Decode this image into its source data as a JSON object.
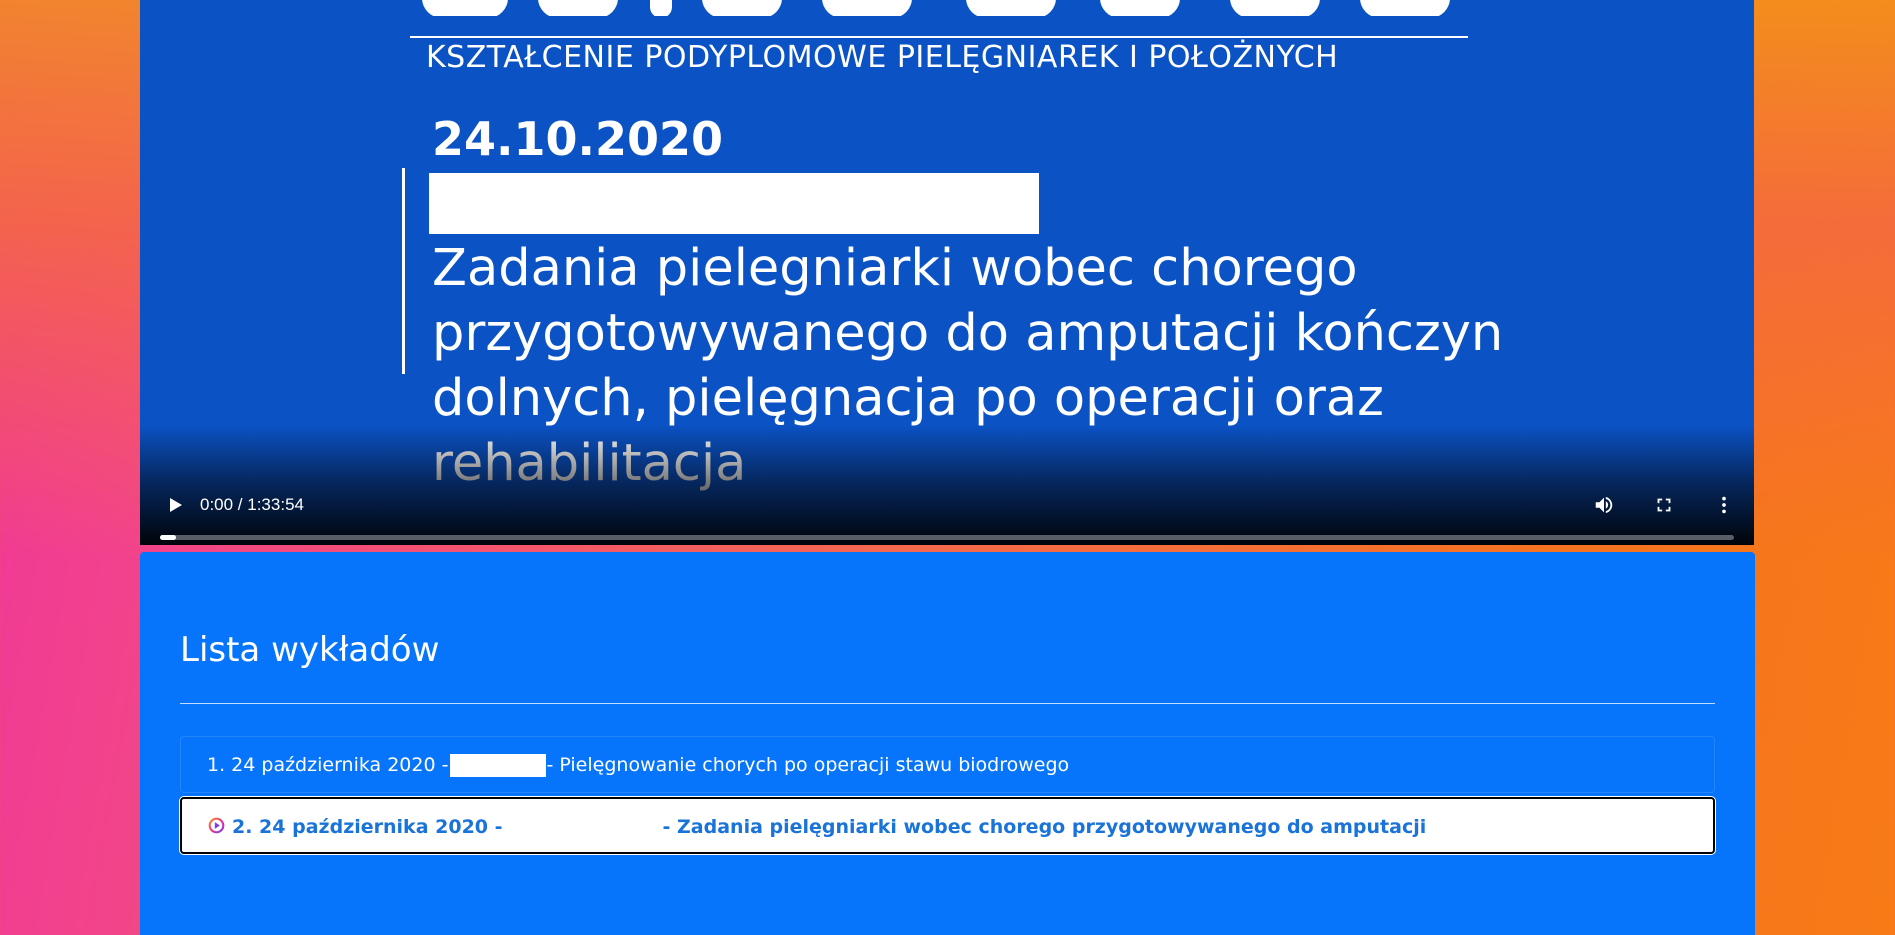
{
  "video": {
    "slide": {
      "subtitle": "KSZTAŁCENIE PODYPLOMOWE PIELĘGNIAREK I POŁOŻNYCH",
      "date": "24.10.2020",
      "title": "Zadania pielegniarki wobec chorego przygotowywanego do amputacji kończyn dolnych, pielęgnacja po operacji oraz rehabilitacja"
    },
    "controls": {
      "time": "0:00 / 1:33:54",
      "progress_fraction": 0.01
    }
  },
  "lectures": {
    "heading": "Lista wykładów",
    "items": [
      {
        "prefix": "1. 24 października 2020 -",
        "suffix": "- Pielęgnowanie chorych po operacji stawu biodrowego",
        "active": false
      },
      {
        "prefix": "2. 24 października 2020 -",
        "suffix": "- Zadania pielęgniarki wobec chorego przygotowywanego do amputacji",
        "active": true
      }
    ]
  },
  "colors": {
    "video_bg": "#0b52c5",
    "panel_bg": "#0675fb",
    "active_text": "#1a73d9"
  }
}
